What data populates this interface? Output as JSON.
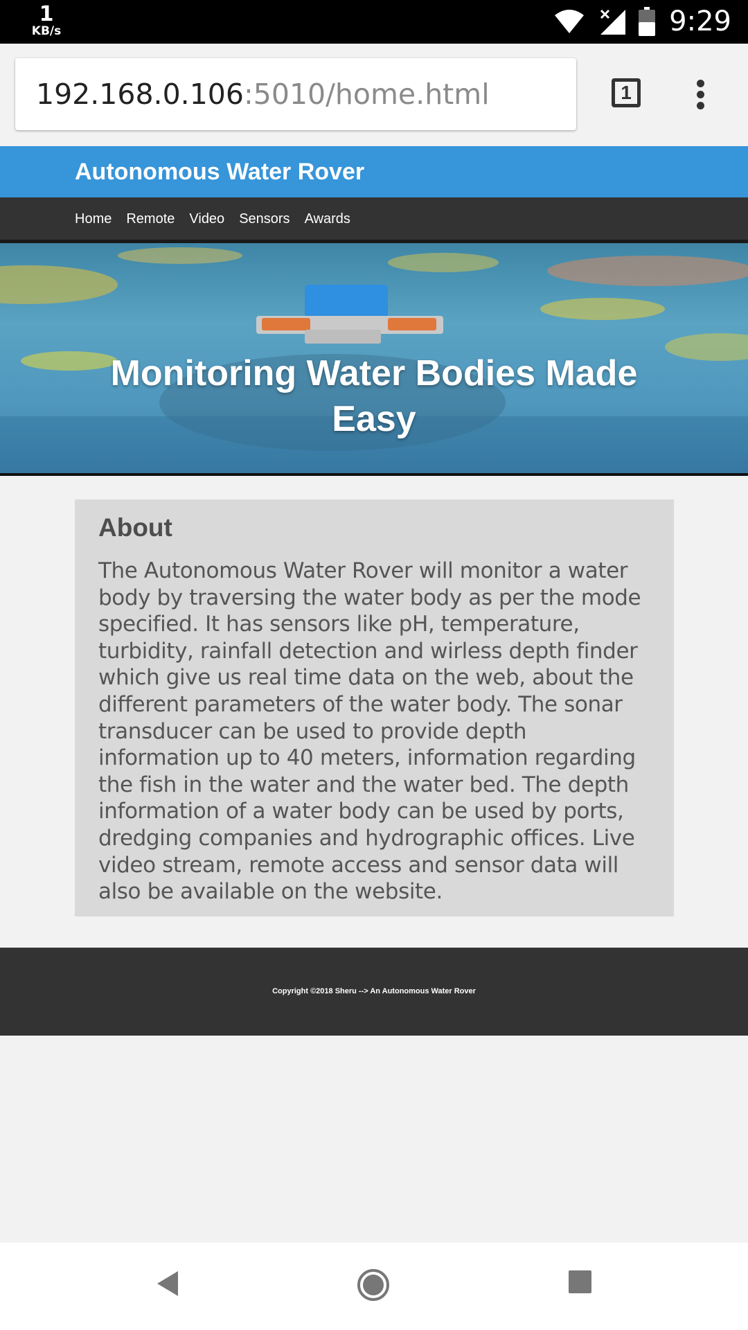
{
  "statusbar": {
    "net_speed_value": "1",
    "net_speed_unit": "KB/s",
    "time": "9:29",
    "icons": [
      "wifi-icon",
      "cell-signal-icon",
      "battery-icon"
    ]
  },
  "browser": {
    "url_host": "192.168.0.106",
    "url_path": ":5010/home.html",
    "tab_count": "1"
  },
  "site": {
    "title": "Autonomous Water Rover",
    "nav": [
      "Home",
      "Remote",
      "Video",
      "Sensors",
      "Awards"
    ],
    "hero_heading": "Monitoring Water Bodies Made Easy",
    "about_heading": "About",
    "about_text": "The Autonomous Water Rover will monitor a water body by traversing the water body as per the mode specified. It has sensors like pH, temperature, turbidity, rainfall detection and wirless depth finder which give us real time data on the web, about the different parameters of the water body. The sonar transducer can be used to provide depth information up to 40 meters, information regarding the fish in the water and the water bed. The depth information of a water body can be used by ports, dredging companies and hydrographic offices. Live video stream, remote access and sensor data will also be available on the website.",
    "footer_text": "Copyright ©2018 Sheru --> An Autonomous Water Rover"
  },
  "colors": {
    "header_blue": "#3795d9",
    "nav_dark": "#333333",
    "about_bg": "#d9d9d9",
    "page_bg": "#f2f2f2"
  },
  "navbar": {
    "icons": [
      "back-icon",
      "home-icon",
      "recents-icon"
    ]
  }
}
